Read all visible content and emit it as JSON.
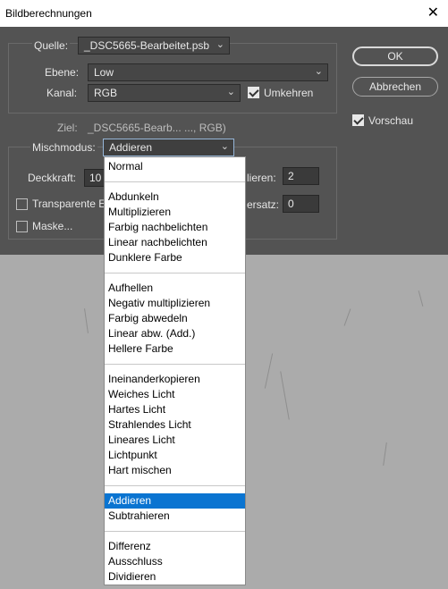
{
  "window": {
    "title": "Bildberechnungen",
    "close_glyph": "✕"
  },
  "source": {
    "label": "Quelle:",
    "value": "_DSC5665-Bearbeitet.psb",
    "layer_label": "Ebene:",
    "layer_value": "Low",
    "channel_label": "Kanal:",
    "channel_value": "RGB",
    "invert_label": "Umkehren",
    "invert_checked": true
  },
  "target": {
    "label": "Ziel:",
    "value": "_DSC5665-Bearb... ..., RGB)"
  },
  "blending": {
    "mode_label": "Mischmodus:",
    "mode_value": "Addieren",
    "opacity_label": "Deckkraft:",
    "opacity_value": "10",
    "scale_label": "lieren:",
    "scale_value": "2",
    "offset_label": "ersatz:",
    "offset_value": "0",
    "transparent_label": "Transparente E",
    "transparent_checked": false,
    "mask_label": "Maske...",
    "mask_checked": false
  },
  "buttons": {
    "ok": "OK",
    "cancel": "Abbrechen"
  },
  "preview": {
    "label": "Vorschau",
    "checked": true
  },
  "dropdown": {
    "selected": "Addieren",
    "items": [
      "Normal",
      "Abdunkeln",
      "Multiplizieren",
      "Farbig nachbelichten",
      "Linear nachbelichten",
      "Dunklere Farbe",
      "Aufhellen",
      "Negativ multiplizieren",
      "Farbig abwedeln",
      "Linear abw. (Add.)",
      "Hellere Farbe",
      "Ineinanderkopieren",
      "Weiches Licht",
      "Hartes Licht",
      "Strahlendes Licht",
      "Lineares Licht",
      "Lichtpunkt",
      "Hart mischen",
      "Addieren",
      "Subtrahieren",
      "Differenz",
      "Ausschluss",
      "Dividieren"
    ]
  },
  "icons": {
    "chevron": "chevron-down-icon",
    "check": "check-icon",
    "close": "close-icon"
  }
}
